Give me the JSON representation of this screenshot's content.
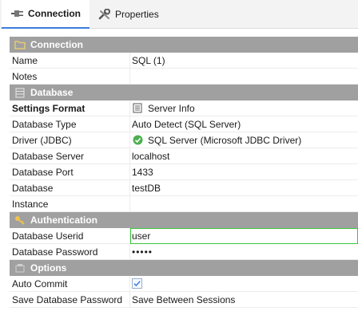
{
  "tabs": [
    {
      "label": "Connection",
      "icon": "plug-icon",
      "active": true
    },
    {
      "label": "Properties",
      "icon": "wrench-icon",
      "active": false
    }
  ],
  "sections": {
    "connection": {
      "title": "Connection",
      "icon": "folder-icon"
    },
    "database": {
      "title": "Database",
      "icon": "database-icon"
    },
    "authentication": {
      "title": "Authentication",
      "icon": "key-icon"
    },
    "options": {
      "title": "Options",
      "icon": "options-icon"
    }
  },
  "rows": {
    "name": {
      "label": "Name",
      "value": "SQL (1)"
    },
    "notes": {
      "label": "Notes",
      "value": ""
    },
    "settings_format": {
      "label": "Settings Format",
      "value": "Server Info",
      "icon": "server-info-icon"
    },
    "database_type": {
      "label": "Database Type",
      "value": "Auto Detect (SQL Server)"
    },
    "driver": {
      "label": "Driver (JDBC)",
      "value": "SQL Server (Microsoft JDBC Driver)",
      "icon": "check-circle-icon"
    },
    "database_server": {
      "label": "Database Server",
      "value": "localhost"
    },
    "database_port": {
      "label": "Database Port",
      "value": "1433"
    },
    "database": {
      "label": "Database",
      "value": "testDB"
    },
    "instance": {
      "label": "Instance",
      "value": ""
    },
    "userid": {
      "label": "Database Userid",
      "value": "user"
    },
    "password": {
      "label": "Database Password",
      "value": "•••••"
    },
    "auto_commit": {
      "label": "Auto Commit",
      "checked": true
    },
    "save_password": {
      "label": "Save Database Password",
      "value": "Save Between Sessions"
    }
  },
  "colors": {
    "section_header": "#a0a0a0",
    "active_input_border": "#3cc43c",
    "check_green": "#4caf50",
    "tab_accent": "#3b7ddd"
  }
}
